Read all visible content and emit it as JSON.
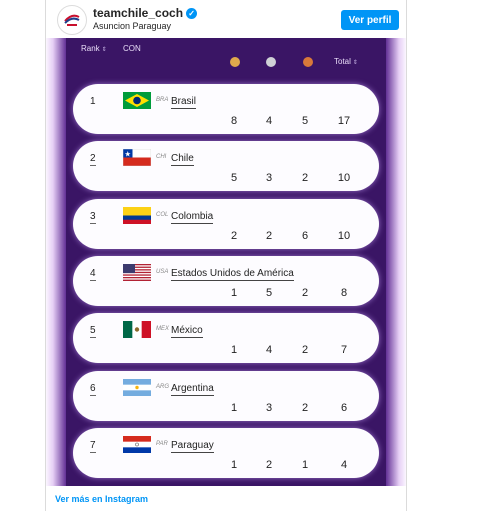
{
  "header": {
    "username": "teamchile_coch",
    "location": "Asuncion Paraguay",
    "follow_button": "Ver perfil"
  },
  "table": {
    "col_rank": "Rank",
    "col_con": "CON",
    "col_total": "Total",
    "medal_colors": {
      "gold": "#e0a94c",
      "silver": "#cfd1d6",
      "bronze": "#d9793a"
    },
    "rows": [
      {
        "rank": "1",
        "code": "BRA",
        "country": "Brasil",
        "gold": "8",
        "silver": "4",
        "bronze": "5",
        "total": "17",
        "flag": "brazil-flag"
      },
      {
        "rank": "2",
        "code": "CHI",
        "country": "Chile",
        "gold": "5",
        "silver": "3",
        "bronze": "2",
        "total": "10",
        "flag": "chile-flag"
      },
      {
        "rank": "3",
        "code": "COL",
        "country": "Colombia",
        "gold": "2",
        "silver": "2",
        "bronze": "6",
        "total": "10",
        "flag": "colombia-flag"
      },
      {
        "rank": "4",
        "code": "USA",
        "country": "Estados Unidos de América",
        "gold": "1",
        "silver": "5",
        "bronze": "2",
        "total": "8",
        "flag": "usa-flag"
      },
      {
        "rank": "5",
        "code": "MEX",
        "country": "México",
        "gold": "1",
        "silver": "4",
        "bronze": "2",
        "total": "7",
        "flag": "mexico-flag"
      },
      {
        "rank": "6",
        "code": "ARG",
        "country": "Argentina",
        "gold": "1",
        "silver": "3",
        "bronze": "2",
        "total": "6",
        "flag": "argentina-flag"
      },
      {
        "rank": "7",
        "code": "PAR",
        "country": "Paraguay",
        "gold": "1",
        "silver": "2",
        "bronze": "1",
        "total": "4",
        "flag": "paraguay-flag"
      }
    ]
  },
  "footer": {
    "link": "Ver más en Instagram"
  },
  "colors": {
    "accent": "#0095f6",
    "panel": "#3a1565"
  }
}
